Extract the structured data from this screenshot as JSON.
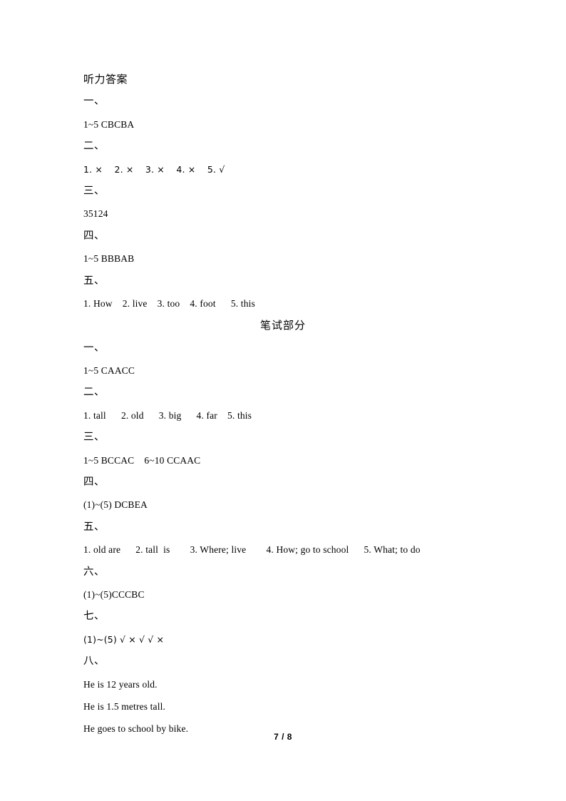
{
  "document": {
    "title": "听力答案",
    "page_number": "7 / 8"
  },
  "listening": {
    "title": "听力答案",
    "sections": [
      {
        "marker": "一、",
        "answer": "1~5 CBCBA"
      },
      {
        "marker": "二、",
        "answer": "1. ×    2. ×    3. ×    4. ×    5. √"
      },
      {
        "marker": "三、",
        "answer": "35124"
      },
      {
        "marker": "四、",
        "answer": "1~5 BBBAB"
      },
      {
        "marker": "五、",
        "answer": "1. How    2. live    3. too    4. foot      5. this"
      }
    ]
  },
  "written": {
    "heading": "笔试部分",
    "sections": [
      {
        "marker": "一、",
        "answer": "1~5 CAACC"
      },
      {
        "marker": "二、",
        "answer": "1. tall      2. old      3. big      4. far    5. this"
      },
      {
        "marker": "三、",
        "answer": "1~5 BCCAC    6~10 CCAAC"
      },
      {
        "marker": "四、",
        "answer": "(1)~(5) DCBEA"
      },
      {
        "marker": "五、",
        "answer": "1. old are      2. tall  is        3. Where; live        4. How; go to school      5. What; to do"
      },
      {
        "marker": "六、",
        "answer": "(1)~(5)CCCBC"
      },
      {
        "marker": "七、",
        "answer": "(1)~(5) √ × √ √ ×"
      },
      {
        "marker": "八、",
        "answer": null
      }
    ],
    "final_answers": [
      "He is 12 years old.",
      "He is 1.5 metres tall.",
      "He goes to school by bike."
    ]
  }
}
